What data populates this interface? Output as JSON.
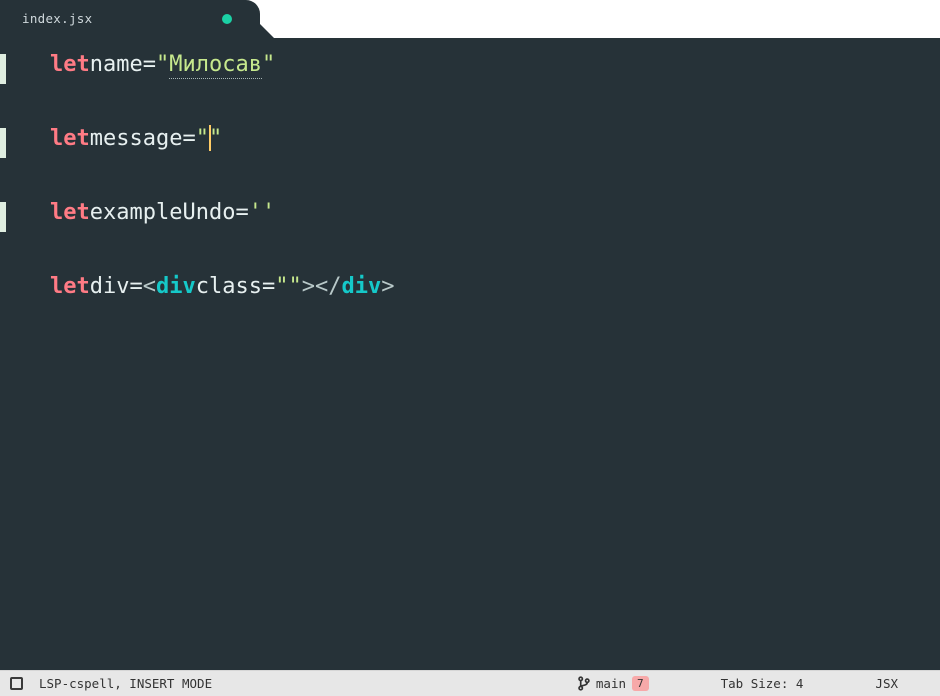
{
  "tab": {
    "filename": "index.jsx",
    "dirty": true
  },
  "code": {
    "line1": {
      "kw": "let",
      "ident": "name",
      "op": "=",
      "q": "\"",
      "value": "Милосав"
    },
    "line2": {
      "kw": "let",
      "ident": "message",
      "op": "=",
      "q": "\"",
      "value": ""
    },
    "line3": {
      "kw": "let",
      "ident": "exampleUndo",
      "op": "=",
      "q": "'",
      "value": ""
    },
    "line4": {
      "kw": "let",
      "ident": "div",
      "op": "=",
      "lt1": "<",
      "tag1": "div",
      "attr": "class",
      "eq": "=",
      "qq": "\"\"",
      "gt1": ">",
      "lt2": "</",
      "tag2": "div",
      "gt2": ">"
    }
  },
  "status": {
    "left": "LSP-cspell, INSERT MODE",
    "branch_name": "main",
    "branch_count": "7",
    "tab_size": "Tab Size: 4",
    "language": "JSX"
  }
}
